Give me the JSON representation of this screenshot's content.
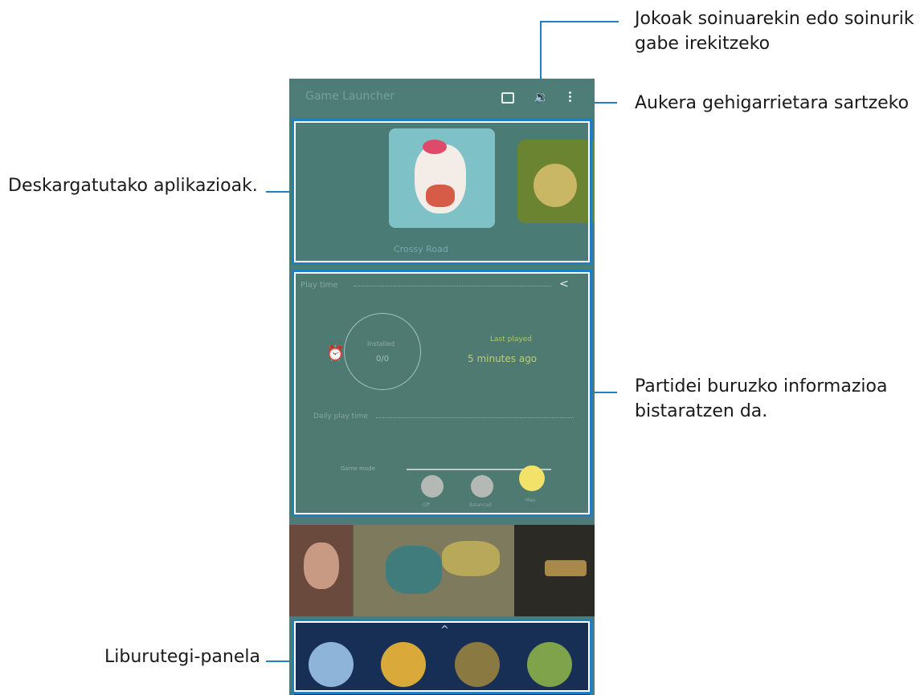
{
  "app": {
    "title": "Game Launcher"
  },
  "callouts": {
    "sound_toggle": "Jokoak soinuarekin edo soinurik gabe irekitzeko",
    "more_options": "Aukera gehigarrietara sartzeko",
    "downloaded_apps": "Deskargatutako aplikazioak.",
    "play_info": "Partidei buruzko informazioa bistaratzen da.",
    "library_panel": "Liburutegi-panela"
  },
  "toolbar": {
    "chat_icon": "chat-icon",
    "sound_icon": "volume-icon",
    "menu_icon": "more-vert-icon"
  },
  "games_section": {
    "featured_game_name": "Crossy Road"
  },
  "play_info": {
    "section_title": "Play time",
    "ring_label": "Installed",
    "ring_value": "0/0",
    "last_played_label": "Last played",
    "last_played_value": "5 minutes ago",
    "subsection_title": "Daily play time",
    "slider_label": "Game mode",
    "slider_options": [
      "Off",
      "Balanced",
      "Max"
    ]
  },
  "colors": {
    "callout_line": "#1f7fc4",
    "header": "#4e7d78",
    "accent_yellow": "#f2e26a",
    "library_bg": "#172e55"
  }
}
